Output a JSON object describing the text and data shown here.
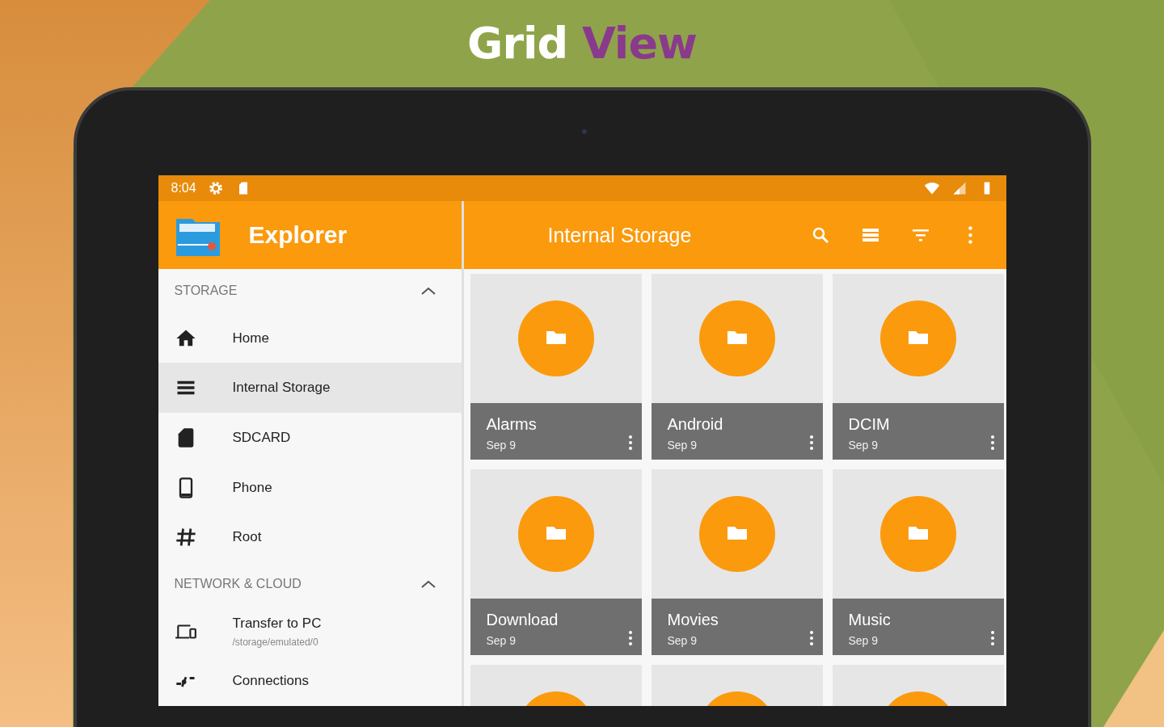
{
  "headline": {
    "plain": "Grid",
    "accent": "View"
  },
  "status_bar": {
    "time": "8:04"
  },
  "sidebar": {
    "title": "Explorer",
    "sections": [
      {
        "title": "STORAGE",
        "expanded": true,
        "items": [
          {
            "kind": "home",
            "label": "Home",
            "selected": false
          },
          {
            "kind": "list",
            "label": "Internal Storage",
            "selected": true
          },
          {
            "kind": "sdcard",
            "label": "SDCARD",
            "selected": false
          },
          {
            "kind": "phone",
            "label": "Phone",
            "selected": false
          },
          {
            "kind": "hash",
            "label": "Root",
            "selected": false
          }
        ]
      },
      {
        "title": "NETWORK & CLOUD",
        "expanded": true,
        "items": [
          {
            "kind": "laptop",
            "label": "Transfer to PC",
            "subtitle": "/storage/emulated/0",
            "selected": false
          },
          {
            "kind": "connections",
            "label": "Connections",
            "selected": false
          }
        ]
      }
    ]
  },
  "toolbar": {
    "title": "Internal Storage"
  },
  "folders": [
    {
      "kind": "folder",
      "name": "Alarms",
      "date": "Sep 9"
    },
    {
      "kind": "folder",
      "name": "Android",
      "date": "Sep 9"
    },
    {
      "kind": "folder",
      "name": "DCIM",
      "date": "Sep 9"
    },
    {
      "kind": "folder",
      "name": "Download",
      "date": "Sep 9"
    },
    {
      "kind": "folder",
      "name": "Movies",
      "date": "Sep 9"
    },
    {
      "kind": "folder",
      "name": "Music",
      "date": "Sep 9"
    },
    {
      "kind": "folder"
    },
    {
      "kind": "folder"
    },
    {
      "kind": "folder"
    }
  ]
}
